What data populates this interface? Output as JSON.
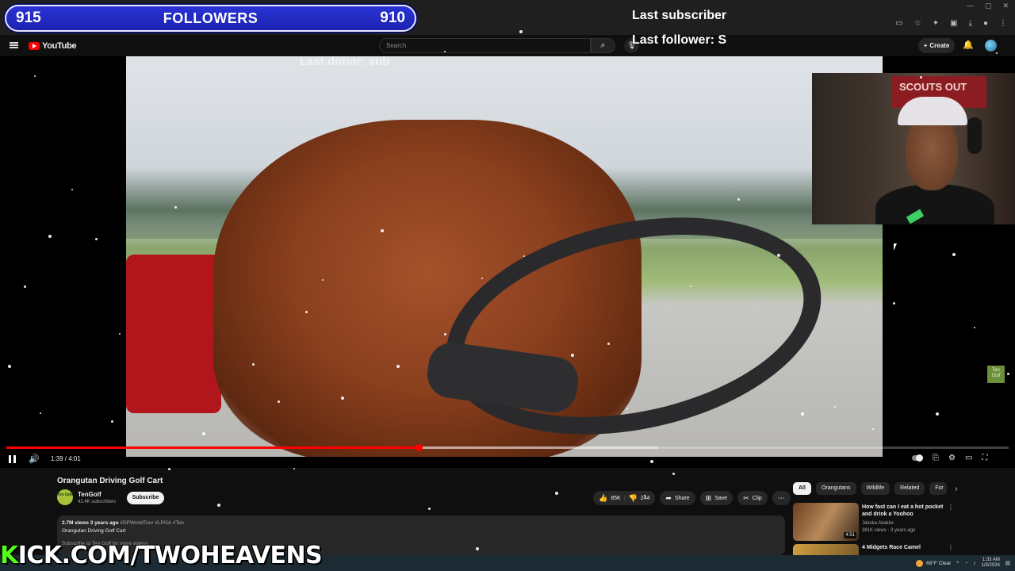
{
  "overlay": {
    "goal_current": "915",
    "goal_label": "FOLLOWERS",
    "goal_target": "910",
    "last_subscriber": "Last subscriber",
    "last_follower": "Last follower: S",
    "last_donor": "Last donor: sub",
    "kick_prefix": "K",
    "kick_rest": "ICK.COM/TWOHEAVENS"
  },
  "youtube": {
    "logo_text": "YouTube",
    "search_placeholder": "Search",
    "create_label": "Create"
  },
  "webcam": {
    "sign_text": "SCOUTS OUT"
  },
  "player": {
    "current_time": "1:39",
    "duration": "4:01",
    "time_display": "1:39 / 4:01",
    "progress_fraction": 0.411,
    "buffer_fraction": 0.65,
    "watermark": "Ten Golf"
  },
  "video": {
    "title": "Orangutan Driving Golf Cart",
    "channel_name": "TenGolf",
    "channel_avatar": "Ten Golf",
    "channel_subs": "42.4K subscribers",
    "subscribe_label": "Subscribe",
    "likes": "85K",
    "dislikes": "244",
    "share_label": "Share",
    "save_label": "Save",
    "clip_label": "Clip",
    "views_line": "2.7M views  3 years ago",
    "tags": "#DPWorldTour #LPGA #Ten",
    "desc_title": "Orangutan Driving Golf Cart",
    "desc_more": "Subscribe to Ten Golf for more videos"
  },
  "chips": [
    "All",
    "Orangutans",
    "Wildlife",
    "Related",
    "For"
  ],
  "recommendations": [
    {
      "title": "How fast can I eat a hot pocket and drink a Yoohoo",
      "channel": "Jakeka Akakke",
      "meta": "381K views · 3 years ago",
      "duration": "4:51"
    },
    {
      "title": "4 Midgets Race Camel",
      "channel": "",
      "meta": "",
      "duration": ""
    }
  ],
  "taskbar": {
    "weather": "68°F  Clear",
    "time": "1:33 AM",
    "date": "1/3/2026"
  },
  "colors": {
    "accent": "#ff0000",
    "goal_bar": "#2a33d6",
    "kick_green": "#53fc18"
  }
}
